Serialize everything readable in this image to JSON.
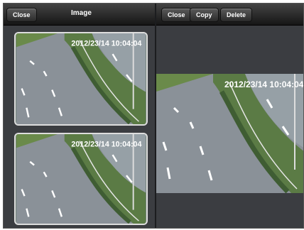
{
  "left_toolbar": {
    "close_label": "Close",
    "title": "Image"
  },
  "right_toolbar": {
    "close_label": "Close",
    "copy_label": "Copy",
    "delete_label": "Delete"
  },
  "thumbnails": [
    {
      "timestamp": "2012/23/14 10:04:04"
    },
    {
      "timestamp": "2012/23/14 10:04:04"
    }
  ],
  "preview": {
    "timestamp": "2012/23/14 10:04:04"
  },
  "colors": {
    "toolbar": "#1f1f1f",
    "background": "#3b3d41",
    "road": "#8a9198",
    "grass": "#6a8a4a"
  }
}
